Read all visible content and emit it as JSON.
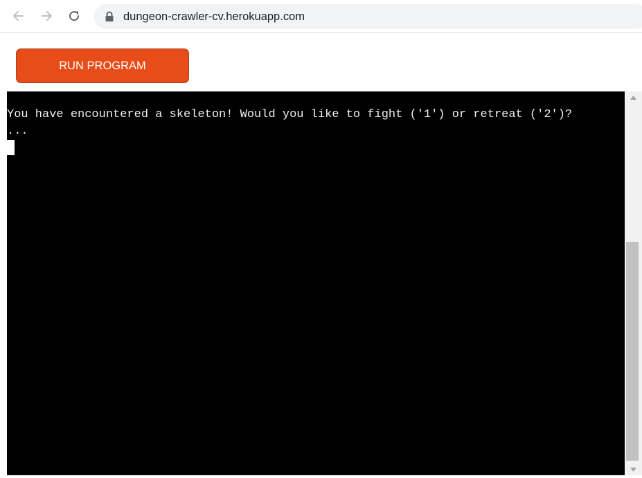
{
  "browser": {
    "url": "dungeon-crawler-cv.herokuapp.com",
    "icons": {
      "back": "arrow-left-icon",
      "forward": "arrow-right-icon",
      "reload": "reload-icon",
      "security": "lock-icon"
    }
  },
  "page": {
    "run_button_label": "RUN PROGRAM",
    "colors": {
      "run_button": "#e84c18",
      "terminal_bg": "#000000",
      "terminal_fg": "#f0f0f0"
    }
  },
  "terminal": {
    "lines": [
      "You have encountered a skeleton! Would you like to fight ('1') or retreat ('2')?",
      "..."
    ]
  }
}
